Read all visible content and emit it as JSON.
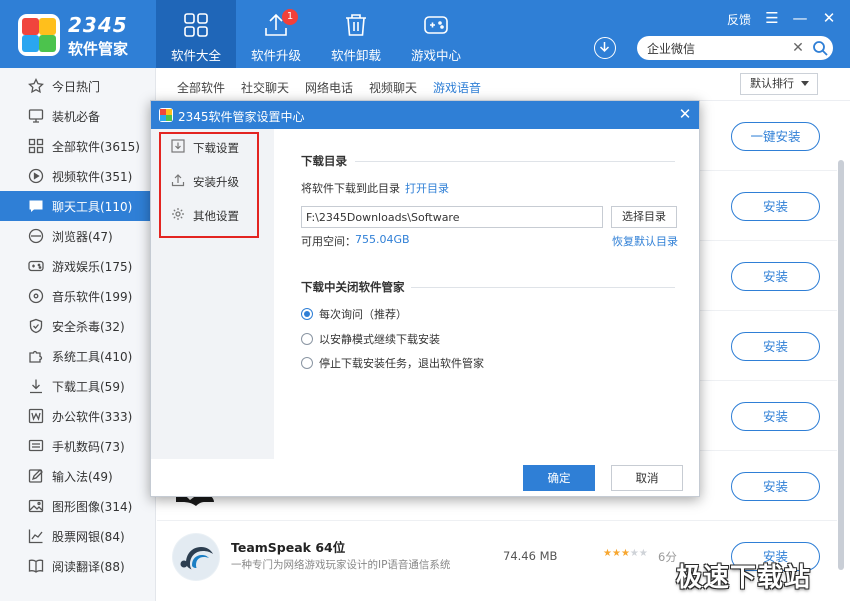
{
  "brand": {
    "number": "2345",
    "name": "软件管家"
  },
  "nav": [
    {
      "label": "软件大全",
      "icon": "grid-icon",
      "active": true
    },
    {
      "label": "软件升级",
      "icon": "upload-icon",
      "badge": "1"
    },
    {
      "label": "软件卸载",
      "icon": "trash-icon"
    },
    {
      "label": "游戏中心",
      "icon": "gamepad-icon"
    }
  ],
  "header": {
    "feedback": "反馈",
    "search_value": "企业微信",
    "clear_symbol": "✕",
    "menu_symbol": "☰",
    "min_symbol": "—",
    "close_symbol": "✕"
  },
  "sidebar": {
    "items": [
      {
        "label": "今日热门",
        "icon": "star-icon"
      },
      {
        "label": "装机必备",
        "icon": "monitor-icon"
      },
      {
        "label": "全部软件(3615)",
        "icon": "apps-icon"
      },
      {
        "label": "视频软件(351)",
        "icon": "play-icon"
      },
      {
        "label": "聊天工具(110)",
        "icon": "chat-icon",
        "active": true
      },
      {
        "label": "浏览器(47)",
        "icon": "browser-icon"
      },
      {
        "label": "游戏娱乐(175)",
        "icon": "gamepad-icon"
      },
      {
        "label": "音乐软件(199)",
        "icon": "music-icon"
      },
      {
        "label": "安全杀毒(32)",
        "icon": "shield-icon"
      },
      {
        "label": "系统工具(410)",
        "icon": "puzzle-icon"
      },
      {
        "label": "下载工具(59)",
        "icon": "download-icon"
      },
      {
        "label": "办公软件(333)",
        "icon": "word-icon"
      },
      {
        "label": "手机数码(73)",
        "icon": "phone-icon"
      },
      {
        "label": "输入法(49)",
        "icon": "edit-icon"
      },
      {
        "label": "图形图像(314)",
        "icon": "image-icon"
      },
      {
        "label": "股票网银(84)",
        "icon": "chart-icon"
      },
      {
        "label": "阅读翻译(88)",
        "icon": "book-icon"
      }
    ]
  },
  "categories": {
    "tabs": [
      "全部软件",
      "社交聊天",
      "网络电话",
      "视频聊天",
      "游戏语音"
    ],
    "active_index": 4,
    "sort_label": "默认排行"
  },
  "list": {
    "one_click_install": "一键安装",
    "install_label": "安装",
    "visible_app": {
      "name": "TeamSpeak 64位",
      "description": "一种专门为网络游戏玩家设计的IP语音通信系统",
      "size": "74.46 MB",
      "rating": 6,
      "stars_total": 5,
      "score_text": "6分"
    }
  },
  "dialog": {
    "title": "2345软件管家设置中心",
    "close_symbol": "✕",
    "nav": [
      {
        "label": "下载设置",
        "icon": "download-settings-icon"
      },
      {
        "label": "安装升级",
        "icon": "upgrade-icon"
      },
      {
        "label": "其他设置",
        "icon": "gear-icon"
      }
    ],
    "download_dir": {
      "heading": "下载目录",
      "hint": "将软件下载到此目录",
      "open_dir": "打开目录",
      "path": "F:\\2345Downloads\\Software",
      "choose_dir": "选择目录",
      "free_space_label": "可用空间：",
      "free_space_value": "755.04GB",
      "restore_default": "恢复默认目录"
    },
    "close_behavior": {
      "heading": "下载中关闭软件管家",
      "options": [
        {
          "label": "每次询问（推荐）",
          "checked": true
        },
        {
          "label": "以安静模式继续下载安装",
          "checked": false
        },
        {
          "label": "停止下载安装任务，退出软件管家",
          "checked": false
        }
      ]
    },
    "ok": "确定",
    "cancel": "取消"
  },
  "watermark": "极速下载站",
  "colors": {
    "primary": "#2f7fd6",
    "highlight_border": "#e32420",
    "star": "#f7a731"
  }
}
